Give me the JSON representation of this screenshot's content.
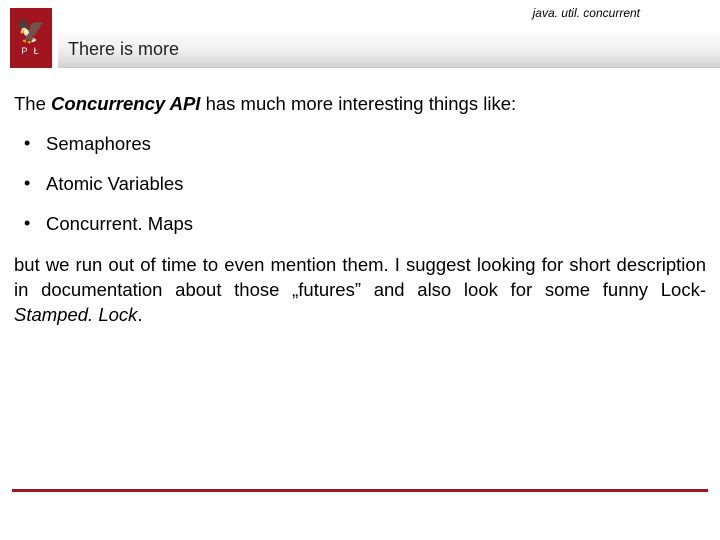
{
  "header": {
    "package_label": "java. util. concurrent",
    "title": "There is more",
    "logo_letters": "P   Ł"
  },
  "content": {
    "intro_prefix": "The ",
    "api_name": "Concurrency API",
    "intro_suffix": " has much more interesting things like:",
    "bullets": [
      "Semaphores",
      "Atomic Variables",
      "Concurrent. Maps"
    ],
    "para_main": "but we run out of time to even mention them. I suggest looking for short description in documentation about those „futures” and also look for some funny Lock- ",
    "stamped": "Stamped. Lock",
    "para_end": "."
  },
  "colors": {
    "brand": "#a01520"
  }
}
